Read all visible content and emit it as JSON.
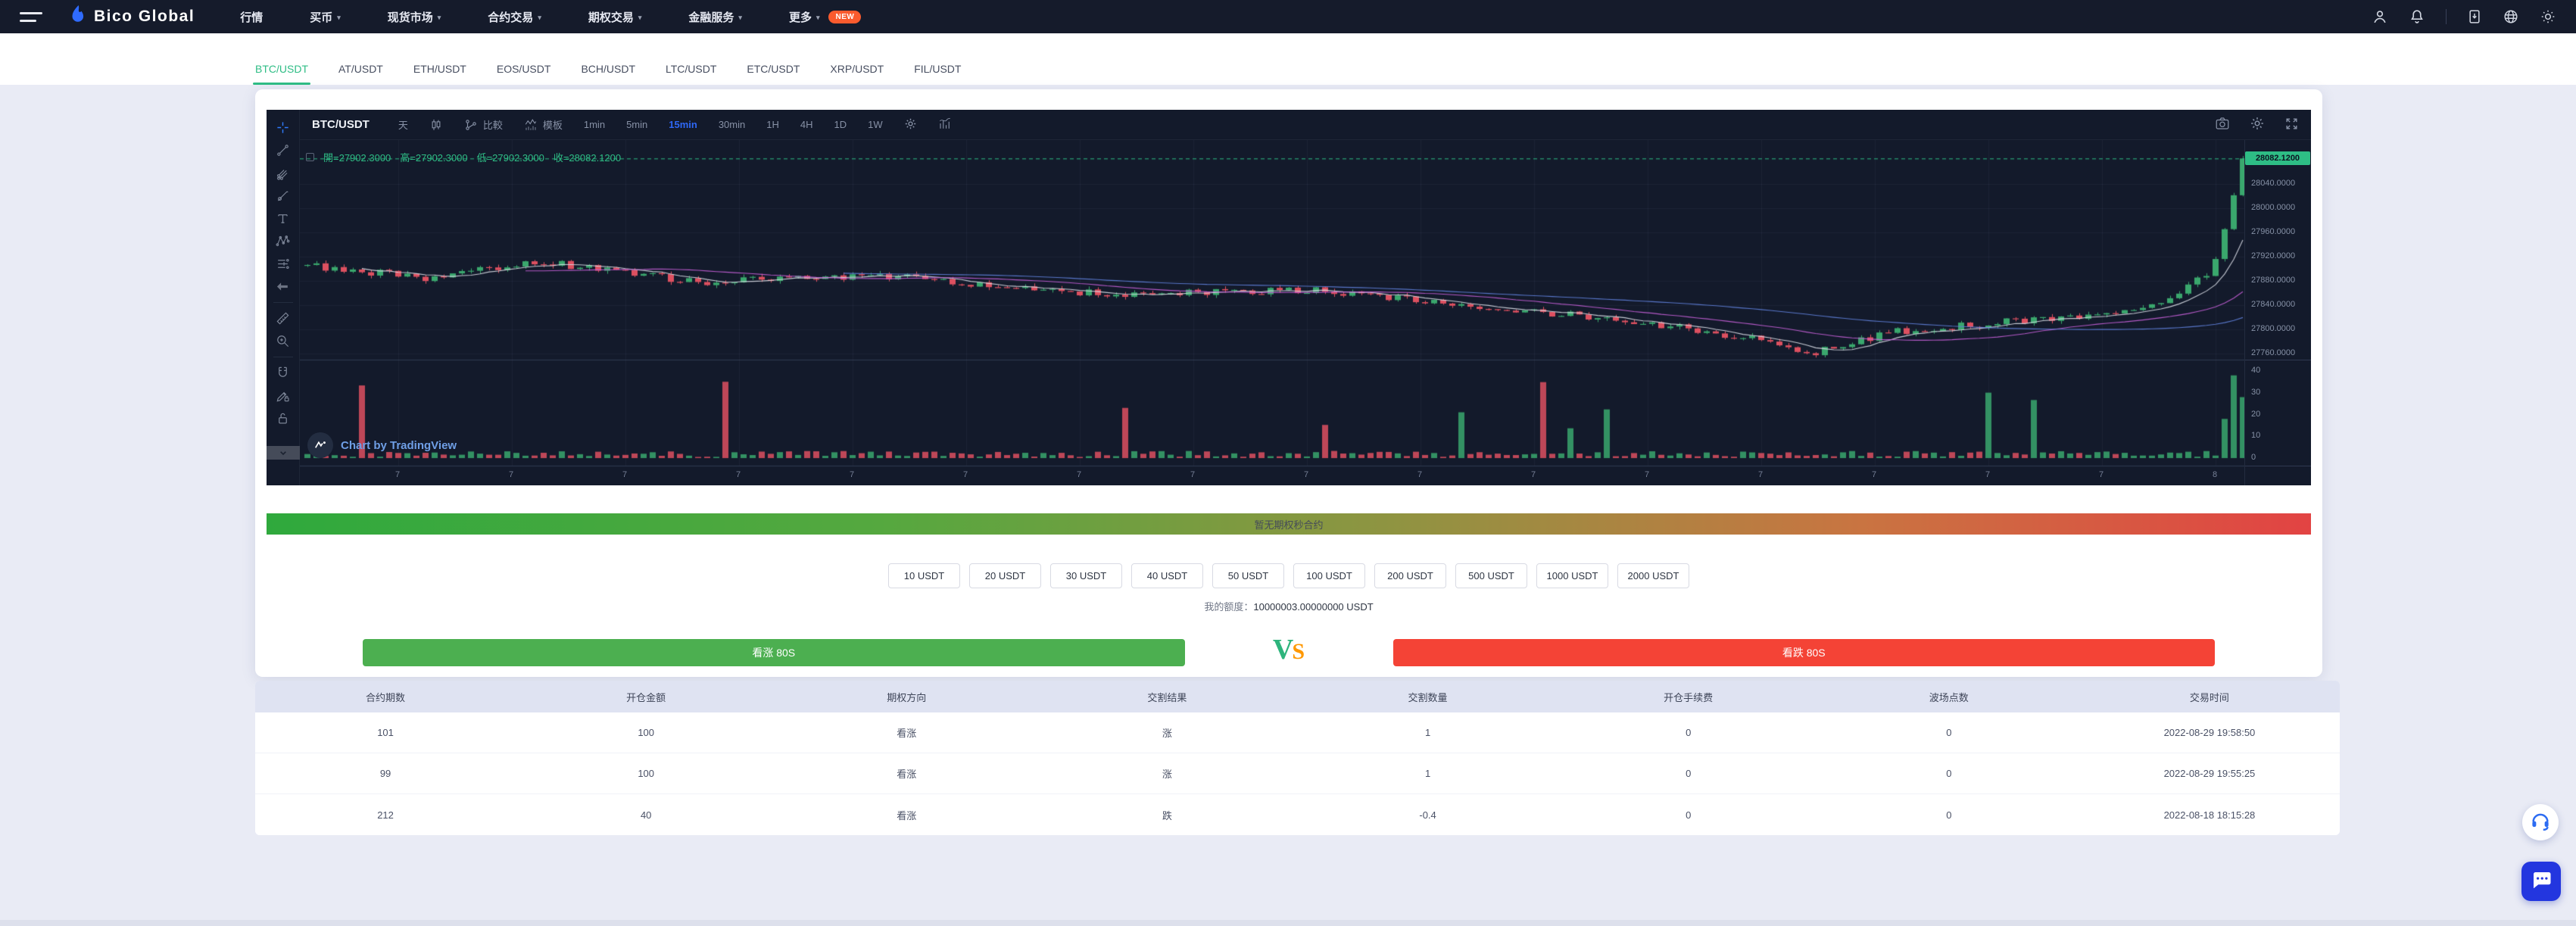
{
  "navbar": {
    "logo_text": "Bico Global",
    "items": [
      {
        "label": "行情",
        "dropdown": false
      },
      {
        "label": "买币",
        "dropdown": true
      },
      {
        "label": "现货市场",
        "dropdown": true
      },
      {
        "label": "合约交易",
        "dropdown": true
      },
      {
        "label": "期权交易",
        "dropdown": true
      },
      {
        "label": "金融服务",
        "dropdown": true
      },
      {
        "label": "更多",
        "dropdown": true
      }
    ],
    "new_badge": "NEW"
  },
  "pair_tabs": {
    "active": "BTC/USDT",
    "items": [
      "BTC/USDT",
      "AT/USDT",
      "ETH/USDT",
      "EOS/USDT",
      "BCH/USDT",
      "LTC/USDT",
      "ETC/USDT",
      "XRP/USDT",
      "FIL/USDT"
    ]
  },
  "chart": {
    "symbol": "BTC/USDT",
    "toolbar": {
      "interval": "天",
      "compare_label": "比較",
      "template_label": "模板",
      "timeframes": [
        "1min",
        "5min",
        "15min",
        "30min",
        "1H",
        "4H",
        "1D",
        "1W"
      ],
      "active_timeframe": "15min"
    },
    "legend_items": [
      "開=27902.3000",
      "高=27902.3000",
      "低=27902.3000",
      "收=28082.1200"
    ],
    "last_price": "28082.1200",
    "price_ticks": [
      "28040.0000",
      "28000.0000",
      "27960.0000",
      "27920.0000",
      "27880.0000",
      "27840.0000",
      "27800.0000",
      "27760.0000"
    ],
    "volume_ticks": [
      "40",
      "30",
      "20",
      "10",
      "0"
    ],
    "time_ticks": [
      "7",
      "7",
      "7",
      "7",
      "7",
      "7",
      "7",
      "7",
      "7",
      "7",
      "7",
      "7",
      "7",
      "7",
      "7",
      "7",
      "8"
    ],
    "attribution": "Chart by TradingView"
  },
  "notice_bar": {
    "text": "暂无期权秒合约"
  },
  "trade_panel": {
    "amounts": [
      "10 USDT",
      "20 USDT",
      "30 USDT",
      "40 USDT",
      "50 USDT",
      "100 USDT",
      "200 USDT",
      "500 USDT",
      "1000 USDT",
      "2000 USDT"
    ],
    "balance_label": "我的额度：",
    "balance_value": "10000003.00000000 USDT",
    "call_label": "看涨 80S",
    "put_label": "看跌 80S",
    "vs_v": "V",
    "vs_s": "S"
  },
  "orders_table": {
    "headers": [
      "合约期数",
      "开仓金额",
      "期权方向",
      "交割结果",
      "交割数量",
      "开仓手续费",
      "波场点数",
      "交易时间"
    ],
    "rows": [
      [
        "101",
        "100",
        "看涨",
        "涨",
        "1",
        "0",
        "0",
        "2022-08-29 19:58:50"
      ],
      [
        "99",
        "100",
        "看涨",
        "涨",
        "1",
        "0",
        "0",
        "2022-08-29 19:55:25"
      ],
      [
        "212",
        "40",
        "看涨",
        "跌",
        "-0.4",
        "0",
        "0",
        "2022-08-18 18:15:28"
      ]
    ]
  },
  "colors": {
    "accent_green": "#2ebd85",
    "candle_up": "#3aa76d",
    "candle_down": "#dd5060",
    "ma_fast": "#d9dde6",
    "ma_mid": "#c45fd6",
    "ma_slow": "#5f7fd9",
    "grid": "rgba(140,160,200,0.07)",
    "timeframe_active": "#2e68f6",
    "call_green": "#4caf50",
    "put_red": "#f44336",
    "new_badge_bg": "#fa5b2e"
  }
}
